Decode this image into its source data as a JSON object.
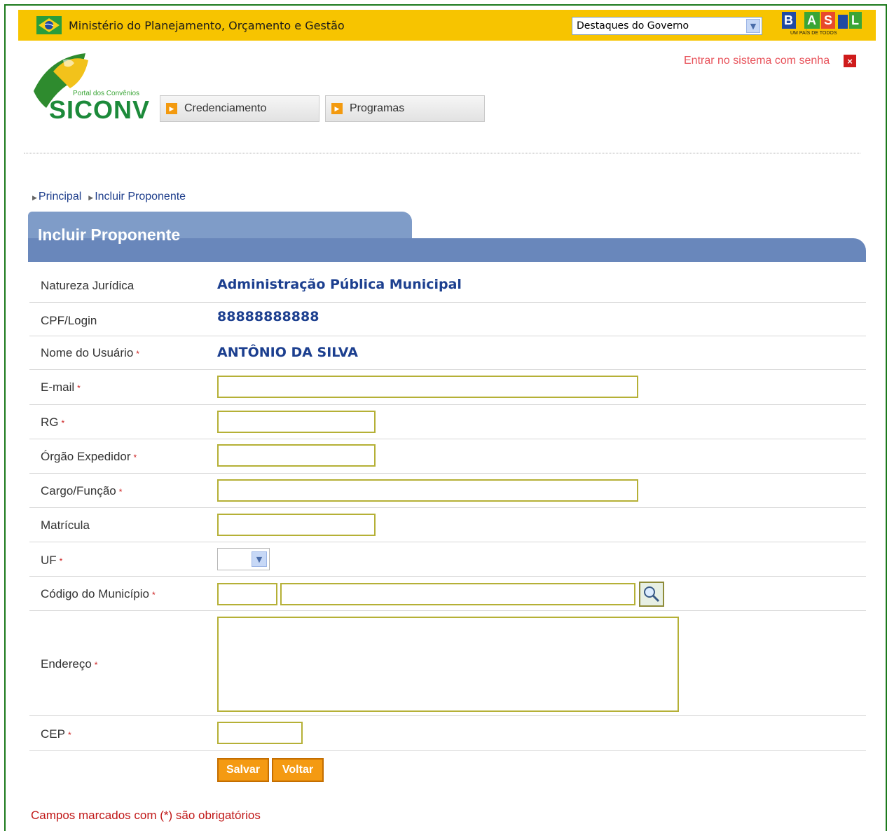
{
  "govbar": {
    "ministry": "Ministério do Planejamento, Orçamento e Gestão",
    "select_value": "Destaques do Governo",
    "brasil_logo_text": "BRASIL",
    "brasil_logo_sub": "UM PAÍS DE TODOS"
  },
  "header": {
    "login_link": "Entrar no sistema com senha",
    "logo_sub": "Portal dos Convênios",
    "logo_word": "SICONV",
    "nav": [
      "Credenciamento",
      "Programas"
    ]
  },
  "breadcrumb": [
    "Principal",
    "Incluir Proponente"
  ],
  "page_title": "Incluir Proponente",
  "form": {
    "natureza_label": "Natureza Jurídica",
    "natureza_value": "Administração Pública Municipal",
    "cpf_label": "CPF/Login",
    "cpf_value": "88888888888",
    "nome_label": "Nome do Usuário",
    "nome_value": "ANTÔNIO DA SILVA",
    "email_label": "E-mail",
    "rg_label": "RG",
    "orgao_label": "Órgão Expedidor",
    "cargo_label": "Cargo/Função",
    "matricula_label": "Matrícula",
    "uf_label": "UF",
    "municipio_label": "Código do Município",
    "endereco_label": "Endereço",
    "cep_label": "CEP",
    "required_mark": "*"
  },
  "buttons": {
    "save": "Salvar",
    "back": "Voltar"
  },
  "note": "Campos marcados com (*) são obrigatórios",
  "colors": {
    "govbar": "#f7c400",
    "title": "#6987bb",
    "button": "#f49a12",
    "required": "#c01818"
  }
}
